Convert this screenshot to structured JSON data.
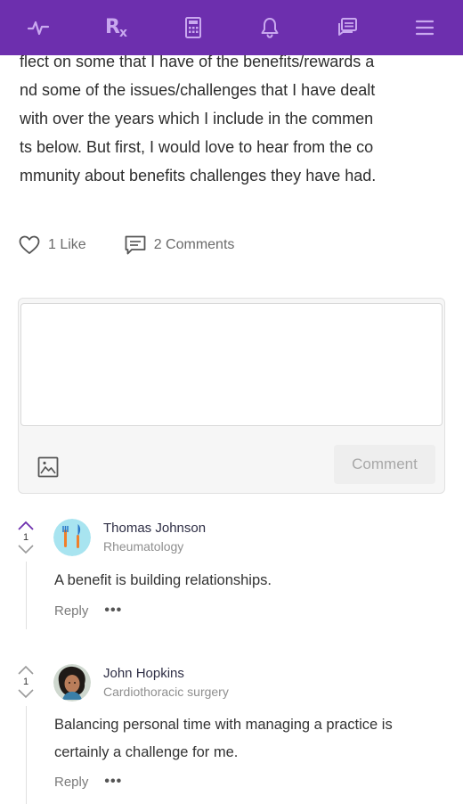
{
  "nav": {
    "items": [
      {
        "name": "activity-icon"
      },
      {
        "name": "rx-icon",
        "label": "Rx"
      },
      {
        "name": "calculator-icon"
      },
      {
        "name": "bell-icon"
      },
      {
        "name": "messages-icon"
      },
      {
        "name": "menu-icon"
      }
    ],
    "background": "#6d2fae",
    "icon_color": "#c9a8ef"
  },
  "post": {
    "lines": [
      "flect on some that I have of the benefits/rewards a",
      "nd some of the issues/challenges that I have dealt",
      "with over the years which I include in the commen",
      "ts below. But first, I would love to hear from the co",
      "mmunity about benefits challenges they have had."
    ],
    "likes_label": "1 Like",
    "comments_label": "2 Comments"
  },
  "composer": {
    "placeholder": "",
    "image_icon": "image-icon",
    "submit_label": "Comment"
  },
  "comments": [
    {
      "votes": "1",
      "author": "Thomas Johnson",
      "specialty": "Rheumatology",
      "text_lines": [
        "A benefit is building relationships."
      ],
      "reply_label": "Reply",
      "more_label": "•••",
      "upvote_active": true
    },
    {
      "votes": "1",
      "author": "John Hopkins",
      "specialty": "Cardiothoracic surgery",
      "text_lines": [
        "Balancing personal time with managing a practice is",
        "certainly a challenge for me."
      ],
      "reply_label": "Reply",
      "more_label": "•••",
      "upvote_active": false
    }
  ]
}
